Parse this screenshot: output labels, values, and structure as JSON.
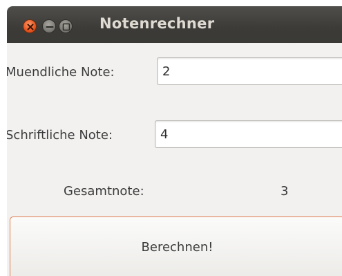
{
  "window": {
    "title": "Notenrechner",
    "controls": {
      "close_icon": "close-icon",
      "minimize_icon": "minimize-icon",
      "maximize_icon": "maximize-icon"
    }
  },
  "form": {
    "oral_label": "Muendliche Note:",
    "oral_value": "2",
    "written_label": "Schriftliche Note:",
    "written_value": "4",
    "total_label": "Gesamtnote:",
    "total_value": "3",
    "calculate_label": "Berechnen!"
  },
  "colors": {
    "titlebar": "#3c3b37",
    "window_bg": "#f2f1f0",
    "close_button": "#e9541e",
    "button_focus_border": "#e07a4a"
  }
}
